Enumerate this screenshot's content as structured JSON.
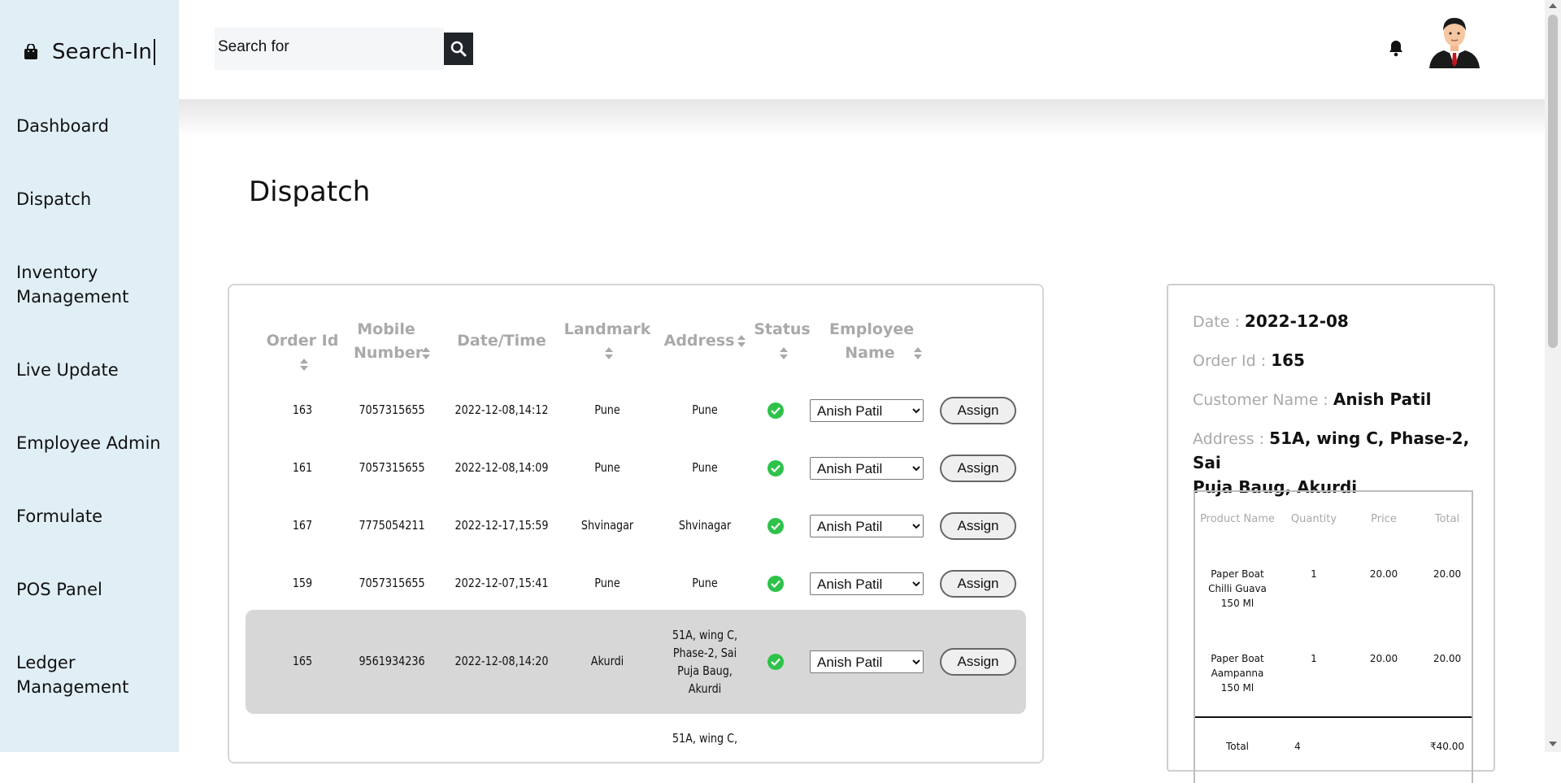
{
  "sidebar": {
    "brand": "Search-In",
    "items": [
      {
        "label": "Dashboard"
      },
      {
        "label": "Dispatch"
      },
      {
        "label": "Inventory Management"
      },
      {
        "label": "Live Update"
      },
      {
        "label": "Employee Admin"
      },
      {
        "label": "Formulate"
      },
      {
        "label": "POS Panel"
      },
      {
        "label": "Ledger Management"
      }
    ]
  },
  "header": {
    "search_placeholder": "Search for",
    "search_icon": "search-icon",
    "notification_icon": "bell-icon",
    "avatar_icon": "user-avatar"
  },
  "main": {
    "title": "Dispatch",
    "table": {
      "columns": [
        "Order Id",
        "Mobile Number",
        "Date/Time",
        "Landmark",
        "Address",
        "Status",
        "Employee Name"
      ],
      "assign_label": "Assign",
      "rows": [
        {
          "order_id": "163",
          "mobile": "7057315655",
          "datetime": "2022-12-08,14:12",
          "landmark": "Pune",
          "address": "Pune",
          "status": "delivered",
          "employee": "Anish Patil"
        },
        {
          "order_id": "161",
          "mobile": "7057315655",
          "datetime": "2022-12-08,14:09",
          "landmark": "Pune",
          "address": "Pune",
          "status": "delivered",
          "employee": "Anish Patil"
        },
        {
          "order_id": "167",
          "mobile": "7775054211",
          "datetime": "2022-12-17,15:59",
          "landmark": "Shvinagar",
          "address": "Shvinagar",
          "status": "delivered",
          "employee": "Anish Patil"
        },
        {
          "order_id": "159",
          "mobile": "7057315655",
          "datetime": "2022-12-07,15:41",
          "landmark": "Pune",
          "address": "Pune",
          "status": "delivered",
          "employee": "Anish Patil"
        },
        {
          "order_id": "165",
          "mobile": "9561934236",
          "datetime": "2022-12-08,14:20",
          "landmark": "Akurdi",
          "address_lines": [
            "51A, wing C,",
            "Phase-2, Sai",
            "Puja Baug,",
            "Akurdi"
          ],
          "status": "delivered",
          "employee": "Anish Patil",
          "selected": true
        },
        {
          "address_partial": "51A, wing C,"
        }
      ]
    }
  },
  "detail": {
    "date_label": "Date : ",
    "date": "2022-12-08",
    "order_id_label": "Order Id : ",
    "order_id": "165",
    "customer_label": "Customer Name : ",
    "customer": "Anish Patil",
    "address_label": "Address : ",
    "address_line1": "51A, wing C, Phase-2, Sai",
    "address_line2": "Puja Baug, Akurdi",
    "items_columns": [
      "Product Name",
      "Quantity",
      "Price",
      "Total"
    ],
    "items": [
      {
        "name_lines": [
          "Paper Boat",
          "Chilli Guava",
          "150 Ml"
        ],
        "qty": "1",
        "price": "20.00",
        "total": "20.00"
      },
      {
        "name_lines": [
          "Paper Boat",
          "Aampanna",
          "150 Ml"
        ],
        "qty": "1",
        "price": "20.00",
        "total": "20.00"
      }
    ],
    "total_label": "Total",
    "total_qty": "4",
    "total_amount": "₹40.00"
  },
  "colors": {
    "sidebar_bg": "#e0eef5",
    "status_green": "#2ec24a",
    "header_gray": "#a9a9a9",
    "selected_row": "#d7d7d7"
  }
}
